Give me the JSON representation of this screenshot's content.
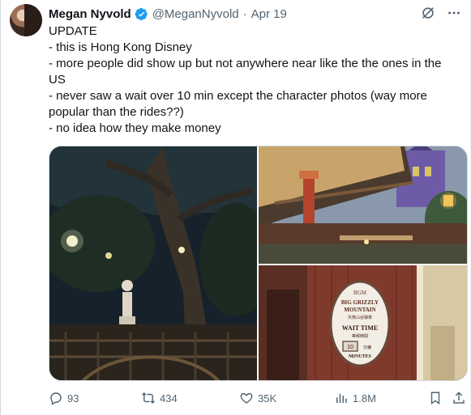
{
  "author": {
    "name": "Megan Nyvold",
    "handle": "@MeganNyvold",
    "separator": "·",
    "date": "Apr 19"
  },
  "tweet": {
    "lines": [
      "UPDATE",
      "- this is Hong Kong Disney",
      "- more people did show up but not anywhere near like the the ones in the US",
      "- never saw a wait over 10 min except the character photos (way more popular than the rides??)",
      "- no idea how they make money"
    ]
  },
  "media": {
    "sign": {
      "brand": "BGM",
      "title_line1": "BIG GRIZZLY",
      "title_line2": "MOUNTAIN",
      "chinese_title": "灰熊山谷礦車",
      "wait_label": "WAIT TIME",
      "chinese_wait": "等候時間",
      "minutes_value": "10",
      "minutes_chinese": "分鐘",
      "minutes_label": "MINUTES"
    }
  },
  "actions": {
    "replies": "93",
    "reposts": "434",
    "likes": "35K",
    "views": "1.8M"
  },
  "icons": {
    "verified": "verified-badge-icon",
    "grok": "grok-icon",
    "more": "more-icon",
    "reply": "reply-icon",
    "repost": "repost-icon",
    "like": "heart-icon",
    "views": "views-icon",
    "bookmark": "bookmark-icon",
    "share": "share-icon"
  },
  "colors": {
    "text": "#0f1419",
    "secondary": "#536471",
    "verified": "#1d9bf0",
    "border": "#cfd9de"
  }
}
